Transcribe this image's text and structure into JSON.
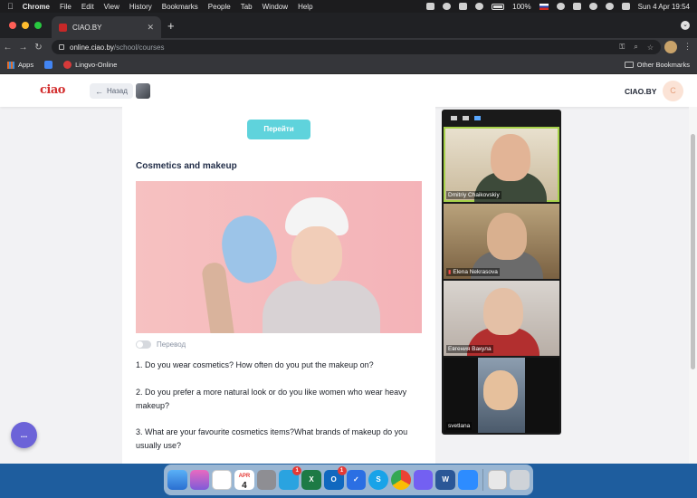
{
  "menubar": {
    "app_name": "Chrome",
    "items": [
      "File",
      "Edit",
      "View",
      "History",
      "Bookmarks",
      "People",
      "Tab",
      "Window",
      "Help"
    ],
    "battery": "100%",
    "datetime": "Sun 4 Apr  19:54"
  },
  "browser": {
    "tab_title": "CIAO.BY",
    "url_host": "online.ciao.by",
    "url_path": "/school/courses",
    "bookmarks": {
      "apps": "Apps",
      "lingvo": "Lingvo-Online",
      "other": "Other Bookmarks"
    }
  },
  "site": {
    "logo": "ciao",
    "back_label": "Назад",
    "brand": "CIAO.BY",
    "user_initial": "C",
    "go_button": "Перейти",
    "section_title": "Cosmetics and makeup",
    "translate_label": "Перевод",
    "questions": [
      "1. Do you wear cosmetics? How often do you put the makeup on?",
      "2. Do you prefer a more natural look or do you like women who wear heavy makeup?",
      "3. What are your favourite cosmetics items?What brands of makeup do you usually use?"
    ],
    "chat_button": "..."
  },
  "zoom": {
    "participants": [
      {
        "name": "Dmitriy Chaikovskiy",
        "muted": false
      },
      {
        "name": "Elena Nekrasova",
        "muted": true
      },
      {
        "name": "Евгения Вакула",
        "muted": false
      },
      {
        "name": "svetlana",
        "muted": false
      }
    ]
  },
  "dock": {
    "calendar_month": "APR",
    "calendar_day": "4",
    "telegram_badge": "1",
    "outlook_badge": "1",
    "excel_letter": "X",
    "outlook_letter": "O",
    "skype_letter": "S",
    "word_letter": "W"
  }
}
